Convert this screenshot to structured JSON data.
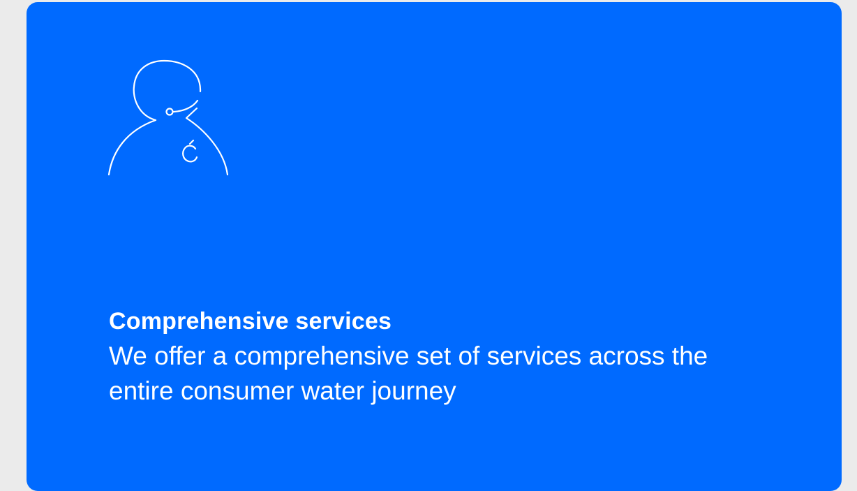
{
  "card": {
    "background": "#006aff",
    "icon": "customer-support-headset-icon",
    "title": "Comprehensive services",
    "description": "We offer a comprehensive set of services across the entire consumer water journey"
  },
  "page": {
    "background": "#ebebeb",
    "text_color": "#ffffff"
  }
}
